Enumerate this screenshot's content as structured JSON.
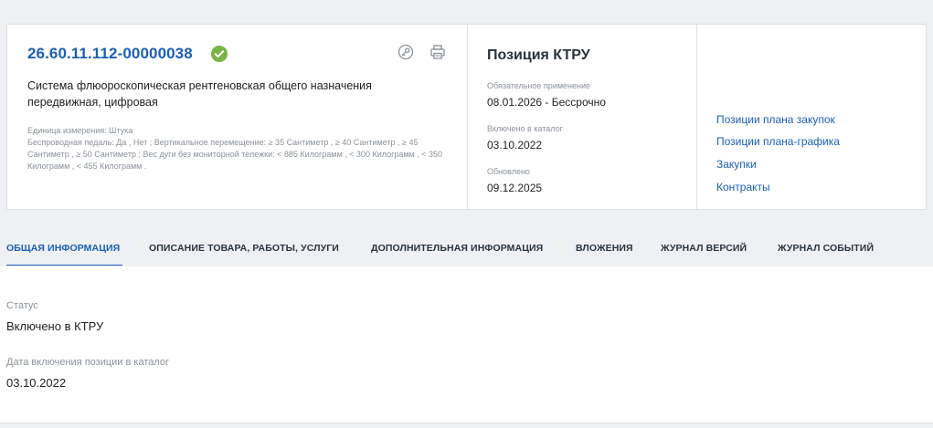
{
  "header": {
    "code": "26.60.11.112-00000038",
    "description": "Система флюороскопическая рентгеновская общего назначения передвижная, цифровая",
    "unit_line": "Единица измерения: Штука",
    "characteristics": "Беспроводная педаль: Да , Нет ; Вертикальное перемещение: ≥ 35 Сантиметр , ≥ 40 Сантиметр , ≥ 45 Сантиметр , ≥ 50 Сантиметр ; Вес дуги без мониторной тележки: < 885 Килограмм , < 300 Килограмм , < 350 Килограмм , < 455 Килограмм ."
  },
  "ktru": {
    "title": "Позиция КТРУ",
    "mandatory_label": "Обязательное применение",
    "mandatory_value": "08.01.2026  - Бессрочно",
    "included_label": "Включено в каталог",
    "included_value": "03.10.2022",
    "updated_label": "Обновлено",
    "updated_value": "09.12.2025"
  },
  "links": [
    "Позиции плана закупок",
    "Позиции плана-графика",
    "Закупки",
    "Контракты"
  ],
  "tabs": [
    "ОБЩАЯ ИНФОРМАЦИЯ",
    "ОПИСАНИЕ ТОВАРА, РАБОТЫ, УСЛУГИ",
    "ДОПОЛНИТЕЛЬНАЯ ИНФОРМАЦИЯ",
    "ВЛОЖЕНИЯ",
    "ЖУРНАЛ ВЕРСИЙ",
    "ЖУРНАЛ СОБЫТИЙ"
  ],
  "active_tab": "ОБЩАЯ ИНФОРМАЦИЯ",
  "general": {
    "status_label": "Статус",
    "status_value": "Включено в КТРУ",
    "date_label": "Дата включения позиции в каталог",
    "date_value": "03.10.2022"
  },
  "colors": {
    "accent": "#1a5fb4",
    "success": "#7cb342",
    "muted": "#8a919b"
  }
}
